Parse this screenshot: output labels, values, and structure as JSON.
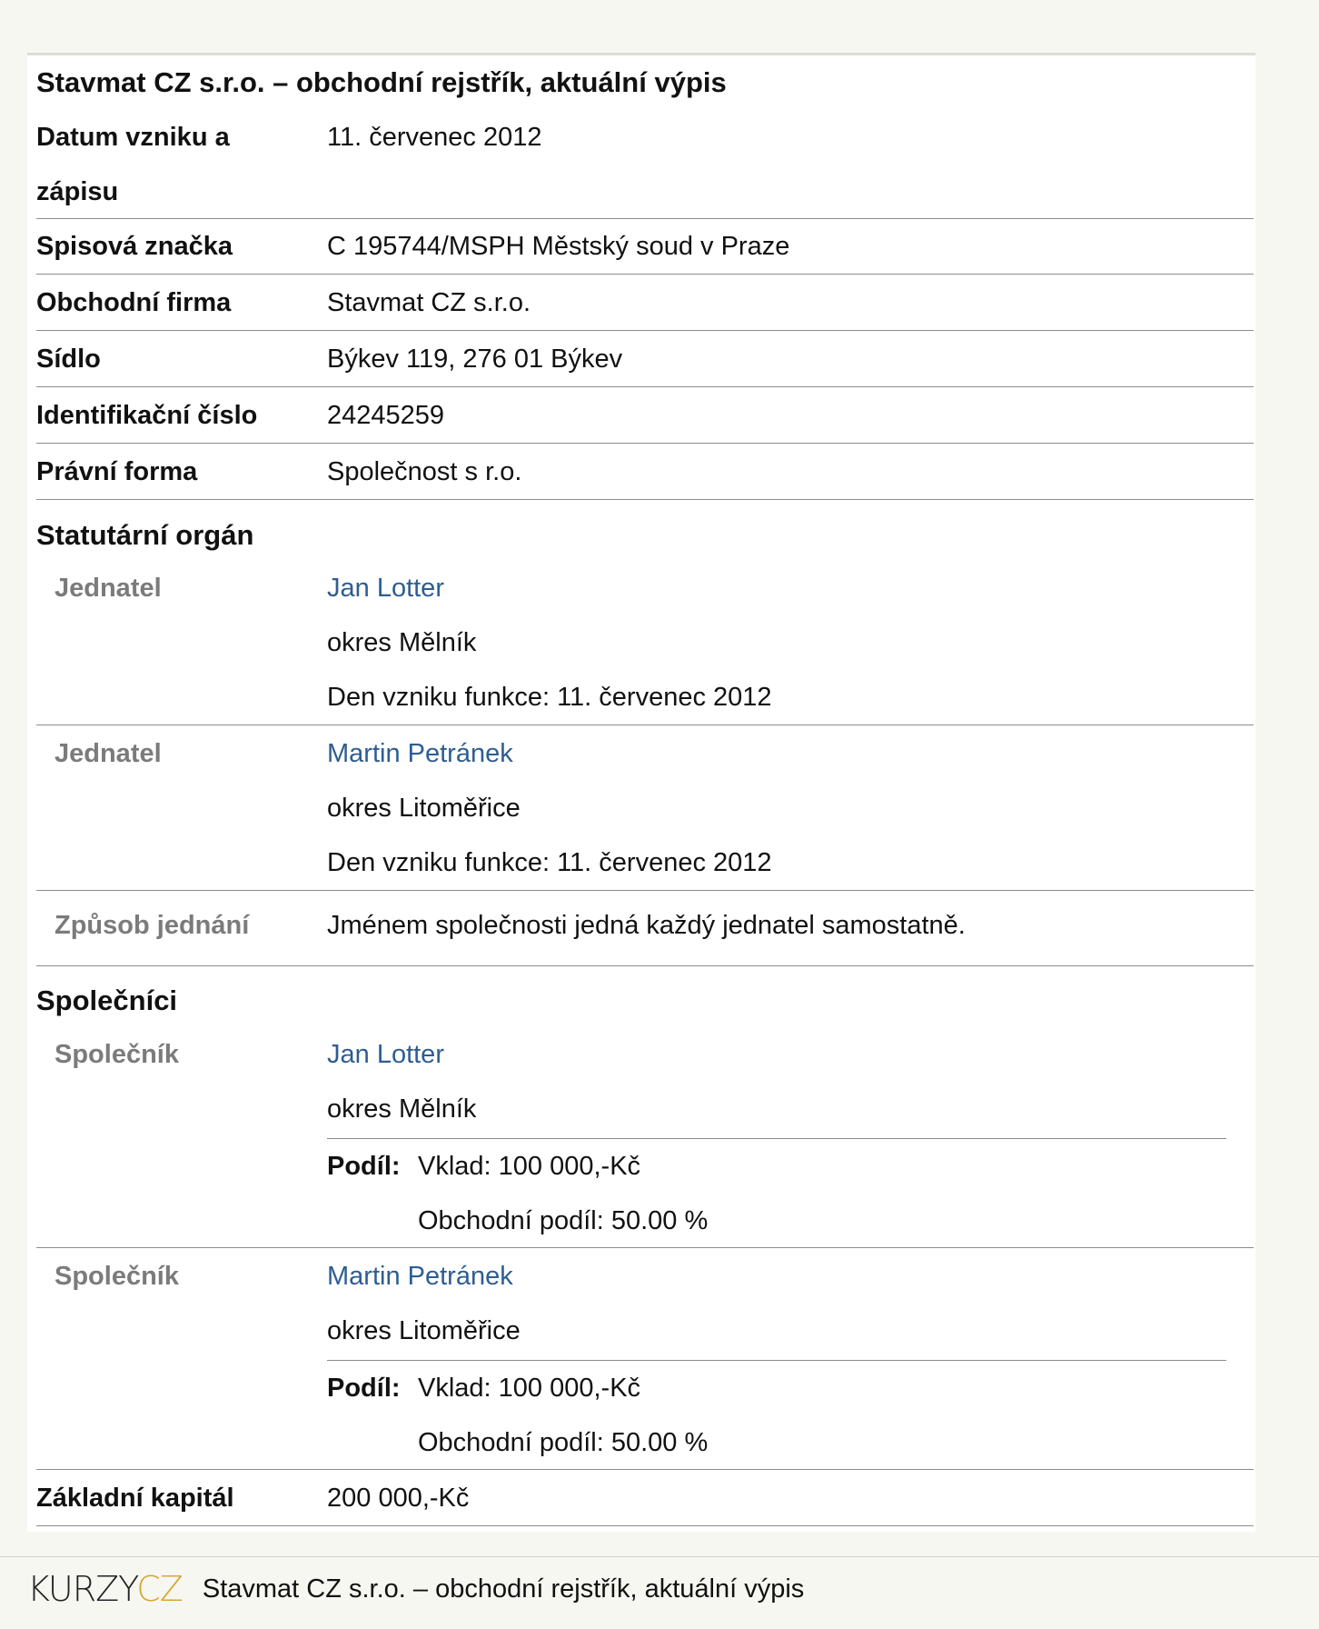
{
  "title": "Stavmat CZ s.r.o. – obchodní rejstřík, aktuální výpis",
  "basic": {
    "datum_label_1": "Datum vzniku a",
    "datum_label_2": "zápisu",
    "datum_value": "11. červenec 2012",
    "spisova_label": "Spisová značka",
    "spisova_value": "C 195744/MSPH Městský soud v Praze",
    "firma_label": "Obchodní firma",
    "firma_value": "Stavmat CZ s.r.o.",
    "sidlo_label": "Sídlo",
    "sidlo_value": "Býkev 119, 276 01 Býkev",
    "ico_label": "Identifikační číslo",
    "ico_value": "24245259",
    "forma_label": "Právní forma",
    "forma_value": "Společnost s r.o."
  },
  "statutarni": {
    "heading": "Statutární orgán",
    "members": [
      {
        "role": "Jednatel",
        "name": "Jan Lotter",
        "district": "okres Mělník",
        "since": "Den vzniku funkce: 11. červenec 2012"
      },
      {
        "role": "Jednatel",
        "name": "Martin Petránek",
        "district": "okres Litoměřice",
        "since": "Den vzniku funkce: 11. červenec 2012"
      }
    ],
    "zpusob_label": "Způsob jednání",
    "zpusob_value": "Jménem společnosti jedná každý jednatel samostatně."
  },
  "spolecnici": {
    "heading": "Společníci",
    "partners": [
      {
        "role": "Společník",
        "name": "Jan Lotter",
        "district": "okres Mělník",
        "share_label": "Podíl:",
        "vklad": "Vklad: 100 000,-Kč",
        "podil": "Obchodní podíl: 50.00 %"
      },
      {
        "role": "Společník",
        "name": "Martin Petránek",
        "district": "okres Litoměřice",
        "share_label": "Podíl:",
        "vklad": "Vklad: 100 000,-Kč",
        "podil": "Obchodní podíl: 50.00 %"
      }
    ]
  },
  "kapital": {
    "label": "Základní kapitál",
    "value": "200 000,-Kč"
  },
  "footer": {
    "logo_part1": "KURZY",
    "logo_part2": "CZ",
    "title": "Stavmat CZ s.r.o. – obchodní rejstřík, aktuální výpis"
  },
  "colors": {
    "link": "#2e5d92",
    "sublabel": "#7b7b7b",
    "logo_accent": "#d9a62e"
  }
}
